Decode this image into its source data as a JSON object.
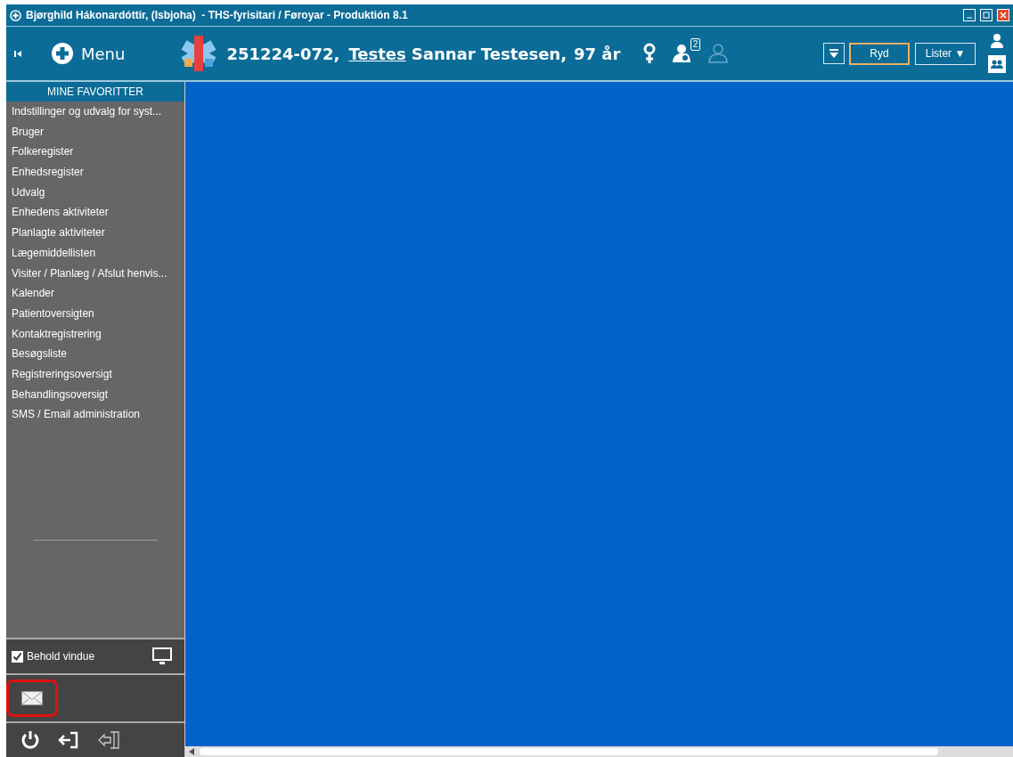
{
  "window": {
    "title": "Bjørghild Hákonardóttir, (Isbjoha)  - THS-fyrisitari / Føroyar - Produktión 8.1"
  },
  "header": {
    "menu_label": "Menu",
    "patient_id": "251224-072,",
    "first_name": "Testes",
    "last_name": "Sannar Testesen,",
    "age": "97 år",
    "relations_badge": "2",
    "buttons": [
      {
        "label": "Ryd",
        "highlighted": true
      },
      {
        "label": "Lister ▼",
        "highlighted": false
      }
    ]
  },
  "sidebar": {
    "title": "MINE FAVORITTER",
    "items": [
      "Indstillinger og udvalg for syst...",
      "Bruger",
      "Folkeregister",
      "Enhedsregister",
      "Udvalg",
      "Enhedens aktiviteter",
      "Planlagte aktiviteter",
      "Lægemiddellisten",
      "Visiter / Planlæg / Afslut henvis...",
      "Kalender",
      "Patientoversigten",
      "Kontaktregistrering",
      "Besøgsliste",
      "Registreringsoversigt",
      "Behandlingsoversigt",
      "SMS / Email administration"
    ],
    "keep_window": {
      "label": "Behold vindue",
      "checked": true
    },
    "mail": {
      "highlighted": true
    }
  }
}
